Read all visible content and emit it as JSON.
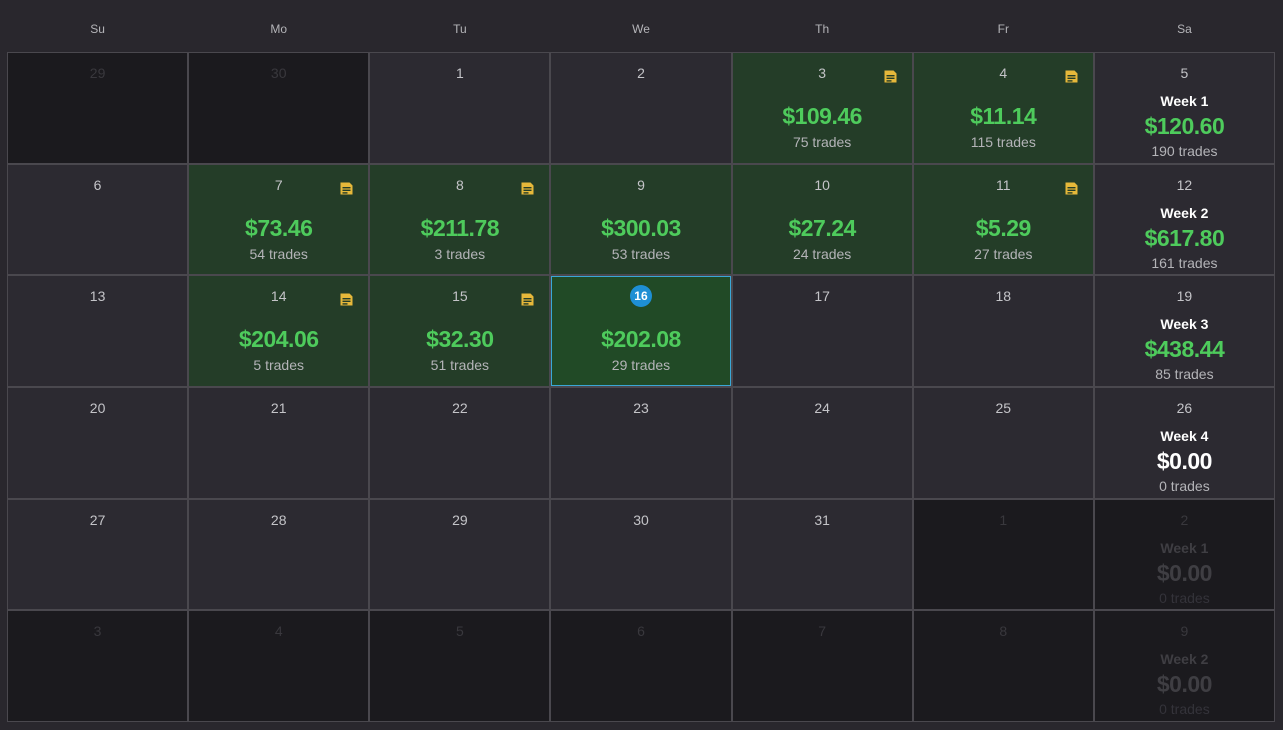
{
  "weekdays": [
    "Su",
    "Mo",
    "Tu",
    "We",
    "Th",
    "Fr",
    "Sa"
  ],
  "colors": {
    "profit_bg": "#243d28",
    "today_bg": "#214a26",
    "profit_text": "#4ecb5c",
    "note_icon": "#e6b83a",
    "today_badge": "#1e8fd4"
  },
  "rows": [
    {
      "days": [
        {
          "day": "29",
          "other": true
        },
        {
          "day": "30",
          "other": true
        },
        {
          "day": "1"
        },
        {
          "day": "2"
        },
        {
          "day": "3",
          "amount": "$109.46",
          "trades": "75 trades",
          "note": true
        },
        {
          "day": "4",
          "amount": "$11.14",
          "trades": "115 trades",
          "note": true
        }
      ],
      "week": {
        "day": "5",
        "label": "Week 1",
        "amount": "$120.60",
        "trades": "190 trades"
      }
    },
    {
      "days": [
        {
          "day": "6"
        },
        {
          "day": "7",
          "amount": "$73.46",
          "trades": "54 trades",
          "note": true
        },
        {
          "day": "8",
          "amount": "$211.78",
          "trades": "3 trades",
          "note": true
        },
        {
          "day": "9",
          "amount": "$300.03",
          "trades": "53 trades"
        },
        {
          "day": "10",
          "amount": "$27.24",
          "trades": "24 trades"
        },
        {
          "day": "11",
          "amount": "$5.29",
          "trades": "27 trades",
          "note": true
        }
      ],
      "week": {
        "day": "12",
        "label": "Week 2",
        "amount": "$617.80",
        "trades": "161 trades"
      }
    },
    {
      "days": [
        {
          "day": "13"
        },
        {
          "day": "14",
          "amount": "$204.06",
          "trades": "5 trades",
          "note": true
        },
        {
          "day": "15",
          "amount": "$32.30",
          "trades": "51 trades",
          "note": true
        },
        {
          "day": "16",
          "amount": "$202.08",
          "trades": "29 trades",
          "today": true
        },
        {
          "day": "17"
        },
        {
          "day": "18"
        }
      ],
      "week": {
        "day": "19",
        "label": "Week 3",
        "amount": "$438.44",
        "trades": "85 trades"
      }
    },
    {
      "days": [
        {
          "day": "20"
        },
        {
          "day": "21"
        },
        {
          "day": "22"
        },
        {
          "day": "23"
        },
        {
          "day": "24"
        },
        {
          "day": "25"
        }
      ],
      "week": {
        "day": "26",
        "label": "Week 4",
        "amount": "$0.00",
        "trades": "0 trades",
        "zero": true
      }
    },
    {
      "days": [
        {
          "day": "27"
        },
        {
          "day": "28"
        },
        {
          "day": "29"
        },
        {
          "day": "30"
        },
        {
          "day": "31"
        },
        {
          "day": "1",
          "other": true
        }
      ],
      "week": {
        "day": "2",
        "label": "Week 1",
        "amount": "$0.00",
        "trades": "0 trades",
        "zero": true,
        "other": true
      }
    },
    {
      "days": [
        {
          "day": "3",
          "other": true
        },
        {
          "day": "4",
          "other": true
        },
        {
          "day": "5",
          "other": true
        },
        {
          "day": "6",
          "other": true
        },
        {
          "day": "7",
          "other": true
        },
        {
          "day": "8",
          "other": true
        }
      ],
      "week": {
        "day": "9",
        "label": "Week 2",
        "amount": "$0.00",
        "trades": "0 trades",
        "zero": true,
        "other": true
      }
    }
  ]
}
